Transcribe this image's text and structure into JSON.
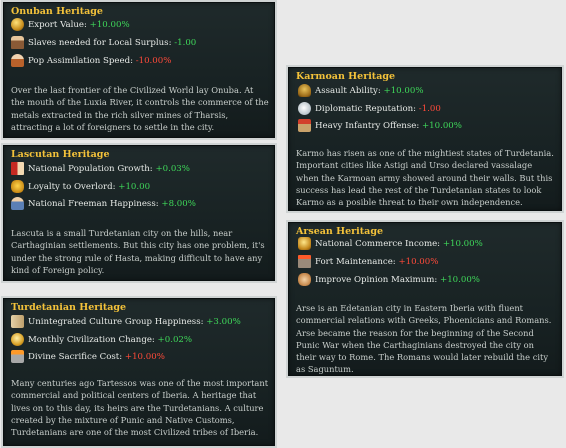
{
  "panels": {
    "onuba": {
      "title": "Onuban Heritage",
      "modifiers": [
        {
          "icon": "gold-coins-icon",
          "label": "Export Value:",
          "value": "+10.00%"
        },
        {
          "icon": "slave-icon",
          "label": "Slaves needed for Local Surplus:",
          "value": "-1.00"
        },
        {
          "icon": "population-icon",
          "label": "Pop Assimilation Speed:",
          "value": "-10.00%"
        }
      ],
      "description": "Over the last frontier of the Civilized World lay Onuba. At the mouth of the Luxia River, it controls the commerce of the metals extracted in the rich silver mines of Tharsis, attracting a lot of foreigners to settle in the city."
    },
    "lascuta": {
      "title": "Lascutan Heritage",
      "modifiers": [
        {
          "icon": "population-growth-icon",
          "label": "National Population Growth:",
          "value": "+0.03%"
        },
        {
          "icon": "loyalty-fist-icon",
          "label": "Loyalty to Overlord:",
          "value": "+10.00"
        },
        {
          "icon": "freemen-icon",
          "label": "National Freeman Happiness:",
          "value": "+8.00%"
        }
      ],
      "description": "Lascuta is a small Turdetanian city on the hills, near Carthaginian settlements. But this city has one problem, it's under the strong rule of Hasta, making difficult to have any kind of Foreign policy."
    },
    "turdetania": {
      "title": "Turdetanian Heritage",
      "modifiers": [
        {
          "icon": "culture-scroll-icon",
          "label": "Unintegrated Culture Group Happiness:",
          "value": "+3.00%"
        },
        {
          "icon": "civilization-coin-icon",
          "label": "Monthly Civilization Change:",
          "value": "+0.02%"
        },
        {
          "icon": "altar-icon",
          "label": "Divine Sacrifice Cost:",
          "value": "+10.00%"
        }
      ],
      "description": "Many centuries ago Tartessos was one of the most important commercial and political centers of Iberia. A heritage that lives on to this day, its heirs are the Turdetanians. A culture created by the mixture of Punic and Native Customs, Turdetanians are one of the most Civilized tribes of Iberia."
    },
    "karmo": {
      "title": "Karmoan Heritage",
      "modifiers": [
        {
          "icon": "helmet-icon",
          "label": "Assault Ability:",
          "value": "+10.00%"
        },
        {
          "icon": "diplomacy-dove-icon",
          "label": "Diplomatic Reputation:",
          "value": "-1.00"
        },
        {
          "icon": "spear-icon",
          "label": "Heavy Infantry Offense:",
          "value": "+10.00%"
        }
      ],
      "description": "Karmo has risen as one of the mightiest states of Turdetania. Important cities like Astigi and Urso declared vassalage when the Karmoan army showed around their walls. But this success has lead the rest of the Turdetanian states to look Karmo as a posible threat to their own independence."
    },
    "arse": {
      "title": "Arsean Heritage",
      "modifiers": [
        {
          "icon": "commerce-coins-icon",
          "label": "National Commerce Income:",
          "value": "+10.00%"
        },
        {
          "icon": "fort-icon",
          "label": "Fort Maintenance:",
          "value": "+10.00%"
        },
        {
          "icon": "handshake-icon",
          "label": "Improve Opinion Maximum:",
          "value": "+10.00%"
        }
      ],
      "description": "Arse is an Edetanian city in Eastern Iberia with fluent commercial relations with Greeks, Phoenicians and Romans. Arse became the reason for the beginning of the Second Punic War when the Carthaginians destroyed the city on their way to Rome. The Romans would later rebuild the city as Saguntum."
    }
  }
}
